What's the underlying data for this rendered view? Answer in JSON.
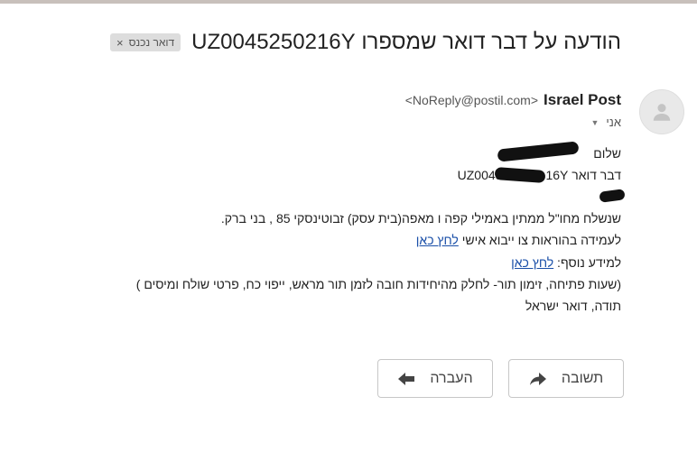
{
  "subject": "הודעה על דבר דואר שמספרו UZ0045250216Y",
  "label": {
    "text": "דואר נכנס",
    "remove": "×"
  },
  "sender": {
    "name": "Israel Post",
    "email": "<NoReply@postil.com>"
  },
  "recipient": {
    "label": "אני"
  },
  "body": {
    "greeting": "שלום",
    "greeting_tail": ",",
    "item_prefix": "דבר דואר",
    "item_start": "UZ0045",
    "item_end": "16Y",
    "line_sent": "שנשלח מחו\"ל ממתין באמילי קפה ו מאפה(בית עסק) זבוטינסקי 85 , בני ברק.",
    "line_instructions": "לעמידה בהוראות צו ייבוא אישי ",
    "link_instructions": "לחץ כאן",
    "line_info": "למידע נוסף: ",
    "link_info": "לחץ כאן",
    "line_hours": "(שעות פתיחה, זימון תור- לחלק מהיחידות חובה לזמן תור מראש, ייפוי כח, פרטי שולח ומיסים )",
    "line_thanks": "תודה, דואר ישראל"
  },
  "actions": {
    "reply": "תשובה",
    "forward": "העברה"
  },
  "icons": {
    "avatar": "person-icon",
    "reply": "reply-arrow-icon",
    "forward": "forward-arrow-icon",
    "caret": "caret-down-icon"
  }
}
